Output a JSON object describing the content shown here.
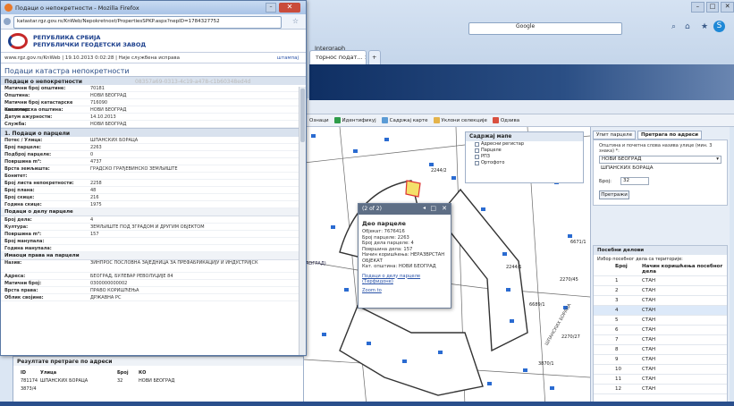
{
  "popup": {
    "window_title": "Подаци о непокретности - Mozilla Firefox",
    "url": "katastar.rgz.gov.rs/KnWeb/Nepokretnost/PropertiesSPKP.aspx?nepID=1784327752",
    "org_line1": "РЕПУБЛИКА СРБИЈА",
    "org_line2": "РЕПУБЛИЧКИ ГЕОДЕТСКИ ЗАВОД",
    "info_line": "www.rgz.gov.rs/KnWeb | 19.10.2013 0:02:28 | Није службена исправа",
    "print_label": "штампај",
    "heading": "Подаци катастра непокретности",
    "section_property": "Подаци о непокретности",
    "property_id": "08357a69-0313-4c19-a478-c1b60348ed4d",
    "property_rows": [
      {
        "k": "Матични број општине:",
        "v": "70181"
      },
      {
        "k": "Општина:",
        "v": "НОВИ БЕОГРАД"
      },
      {
        "k": "Матични број катастарске општине:",
        "v": "716090"
      },
      {
        "k": "Катастарска општина:",
        "v": "НОВИ БЕОГРАД"
      },
      {
        "k": "Датум ажурности:",
        "v": "14.10.2013"
      },
      {
        "k": "Служба:",
        "v": "НОВИ БЕОГРАД"
      }
    ],
    "section_parcel": "1. Подаци о парцели",
    "parcel_rows": [
      {
        "k": "Потес / Улица:",
        "v": "ШПАНСКИХ БОРАЦА"
      },
      {
        "k": "Број парцеле:",
        "v": "2263"
      },
      {
        "k": "Подброј парцеле:",
        "v": "0"
      },
      {
        "k": "Површина m²:",
        "v": "4737"
      },
      {
        "k": "Врста земљишта:",
        "v": "ГРАДСКО ГРАЂЕВИНСКО ЗЕМЉИШТЕ"
      },
      {
        "k": "Бонитет:",
        "v": ""
      },
      {
        "k": "Број листа непокретности:",
        "v": "2258"
      },
      {
        "k": "Број плана:",
        "v": "48"
      },
      {
        "k": "Број скице:",
        "v": "216"
      },
      {
        "k": "Година скице:",
        "v": "1975"
      }
    ],
    "sub_part": "Подаци о делу парцеле",
    "part_rows": [
      {
        "k": "Број дела:",
        "v": "4"
      },
      {
        "k": "Култура:",
        "v": "ЗЕМЉИШТЕ ПОД ЗГРАДОМ И ДРУГИМ ОБЈЕКТОМ"
      },
      {
        "k": "Површина m²:",
        "v": "157"
      },
      {
        "k": "Број манупала:",
        "v": ""
      },
      {
        "k": "Година манупала:",
        "v": ""
      }
    ],
    "sub_holders": "Имаоци права на парцели",
    "holder_rows": [
      {
        "k": "Назив:",
        "v": "ЗИНПРОС ПОСЛОВНА ЗАЈЕДНИЦА ЗА ПРЕФАБРИКАЦИЈУ И ИНДУСТРИЈСК"
      },
      {
        "k": "Адреса:",
        "v": "БЕОГРАД, БУЛЕВАР РЕВОЛУЦИЈЕ 84"
      },
      {
        "k": "Матични број:",
        "v": "0300000000002"
      },
      {
        "k": "Врста права:",
        "v": "ПРАВО КОРИШЋЕЊА"
      },
      {
        "k": "Облик својине:",
        "v": "ДРЖАВНА РС"
      }
    ]
  },
  "browser": {
    "search_placeholder": "Google",
    "tab_label": "Intergraph",
    "tab2_label": "торнос подат...",
    "tab_close": "×",
    "new_tab": "+"
  },
  "toolbar": {
    "items": [
      "Ознаци",
      "Идентификуј",
      "Садржај карте",
      "Уклони селекције",
      "Одзива"
    ]
  },
  "layers": {
    "title": "Садржај мапе",
    "items": [
      "Адресни регистар",
      "Парцеле",
      "РПЗ",
      "Ортофото"
    ]
  },
  "infowindow": {
    "counter": "(2 of 2)",
    "title": "Део парцеле",
    "lines": [
      "Објекат: 7676416",
      "Број парцеле: 2263",
      "Број дела парцеле: 4",
      "Површина дела: 157",
      "Начин коришћења: НЕРАЗВРСТАН",
      "ОБЈЕКАТ",
      "Кат. општина: НОВИ БЕОГРАД"
    ],
    "link1": "Подаци о делу парцеле (Терфидоне)",
    "link2": "Zoom to"
  },
  "rpanel": {
    "tabs": [
      "Упит парцеле",
      "Претрага по адреси"
    ],
    "hint": "Општина и почетна слова назива улице (мин. 3 знака) *:",
    "municipality": "НОВИ БЕОГРАД",
    "street": "ШПАНСКИХ БОРАЦА",
    "number_label": "Број:",
    "number": "32",
    "search_btn": "Претражи",
    "parts_title": "Посебни делови",
    "parts_hint": "Избор посебног дела са територије:",
    "col1": "Број",
    "col2": "Начин коришћења посебног дела",
    "rows": [
      {
        "n": "1",
        "t": "СТАН"
      },
      {
        "n": "2",
        "t": "СТАН"
      },
      {
        "n": "3",
        "t": "СТАН"
      },
      {
        "n": "4",
        "t": "СТАН"
      },
      {
        "n": "5",
        "t": "СТАН"
      },
      {
        "n": "6",
        "t": "СТАН"
      },
      {
        "n": "7",
        "t": "СТАН"
      },
      {
        "n": "8",
        "t": "СТАН"
      },
      {
        "n": "9",
        "t": "СТАН"
      },
      {
        "n": "10",
        "t": "СТАН"
      },
      {
        "n": "11",
        "t": "СТАН"
      },
      {
        "n": "12",
        "t": "СТАН"
      }
    ]
  },
  "results": {
    "title": "Резултате претраге по адреси",
    "cols": [
      "ID",
      "Улица",
      "Број",
      "КО"
    ],
    "row": [
      "781174",
      "ШПАНСКИХ БОРАЦА",
      "32",
      "НОВИ БЕОГРАД"
    ],
    "row2": "3873/4"
  },
  "map_labels": {
    "l1": "2244/2",
    "l2": "2244/1",
    "l3": "2270/45",
    "l4": "6671/1",
    "l5": "2270/27",
    "l6": "3870/1",
    "l7": "6689/1",
    "street": "ШПАНСКИХ БОРАЦА",
    "road": "АОГРАД)"
  },
  "colors": {
    "accent": "#2a4d86",
    "selected": "#dce9f9",
    "alert": "#c94b3b"
  }
}
